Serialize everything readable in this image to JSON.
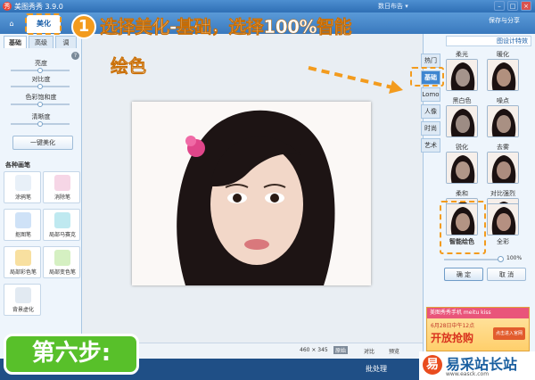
{
  "window": {
    "title": "美图秀秀 3.9.0",
    "menu": "数日布告 ▾"
  },
  "tabs": {
    "home": "⌂",
    "beautify": "美化",
    "third": "美"
  },
  "toolbar": {
    "save_share": "保存与分享"
  },
  "left_panel": {
    "subtabs": [
      "基础",
      "高级",
      "调"
    ],
    "sliders": [
      {
        "label": "亮度",
        "value": 0.5
      },
      {
        "label": "对比度",
        "value": 0.5
      },
      {
        "label": "色彩饱和度",
        "value": 0.5
      },
      {
        "label": "清晰度",
        "value": 0.5
      }
    ],
    "one_key_button": "一键美化",
    "pens_header": "各种画笔",
    "pens": [
      {
        "label": "涂鸦笔",
        "color": "#e8f0f8"
      },
      {
        "label": "消除笔",
        "color": "#f6d6e6"
      },
      {
        "label": "抠图笔",
        "color": "#cfe2f7"
      },
      {
        "label": "局部马赛克",
        "color": "#bfe9f0"
      },
      {
        "label": "局部彩色笔",
        "color": "#f8e0a0"
      },
      {
        "label": "局部变色笔",
        "color": "#d5f0c2"
      },
      {
        "label": "背景虚化",
        "color": "#e2eaf2"
      }
    ]
  },
  "annotation": {
    "step_number": "1",
    "text_line1": "选择美化-基础，选择100%智能",
    "text_line2": "绘色",
    "step_label": "第六步:"
  },
  "right_panel": {
    "effects_link": "图设计特效",
    "vtabs": [
      "热门",
      "基础",
      "Lomo",
      "人像",
      "时尚",
      "艺术"
    ],
    "active_vtab": "基础",
    "effects": [
      {
        "label": "柔光",
        "tone": "#8a8a8a"
      },
      {
        "label": "暖化",
        "tone": "#b77b55"
      },
      {
        "label": "黑白色",
        "tone": "#6d6d6d"
      },
      {
        "label": "噪点",
        "tone": "#9a7a6a"
      },
      {
        "label": "锐化",
        "tone": "#b58f7a"
      },
      {
        "label": "去雾",
        "tone": "#a56d57"
      },
      {
        "label": "柔和",
        "tone": "#c79a84"
      },
      {
        "label": "对比强烈",
        "tone": "#94593f"
      },
      {
        "label": "智能绘色",
        "tone": "#bd8a6e"
      },
      {
        "label": "全彩",
        "tone": "#c47a60"
      }
    ],
    "selected_effect": "智能绘色",
    "opacity_label": "100%",
    "confirm": "确 定",
    "cancel": "取 消",
    "ad_title": "美图秀秀手机 meitu kiss",
    "ad_sub": "6月28日中午12点",
    "ad_big": "开放抢购",
    "ad_button": "点击进入官网"
  },
  "statusbar": {
    "size": "460 × 345",
    "zoom": "原始",
    "compare": "对比",
    "preview": "预览"
  },
  "bottom": {
    "batch": "批处理",
    "watermark": "易采站长站",
    "watermark_url": "www.easck.com"
  }
}
